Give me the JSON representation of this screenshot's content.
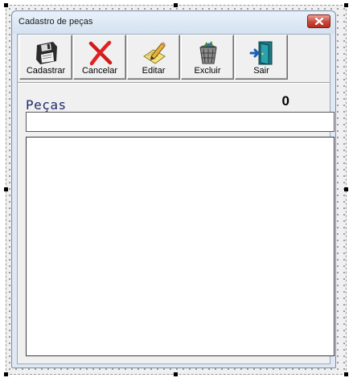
{
  "window": {
    "title": "Cadastro de peças"
  },
  "toolbar": {
    "buttons": [
      {
        "id": "cadastrar",
        "label": "Cadastrar",
        "icon": "floppy-disk-icon"
      },
      {
        "id": "cancelar",
        "label": "Cancelar",
        "icon": "red-x-icon"
      },
      {
        "id": "editar",
        "label": "Editar",
        "icon": "edit-pencil-icon"
      },
      {
        "id": "excluir",
        "label": "Excluir",
        "icon": "trash-bin-icon"
      },
      {
        "id": "sair",
        "label": "Sair",
        "icon": "exit-door-icon"
      }
    ]
  },
  "main": {
    "section_label": "Peças",
    "count": "0",
    "search": {
      "value": "",
      "placeholder": ""
    },
    "list_items": []
  }
}
